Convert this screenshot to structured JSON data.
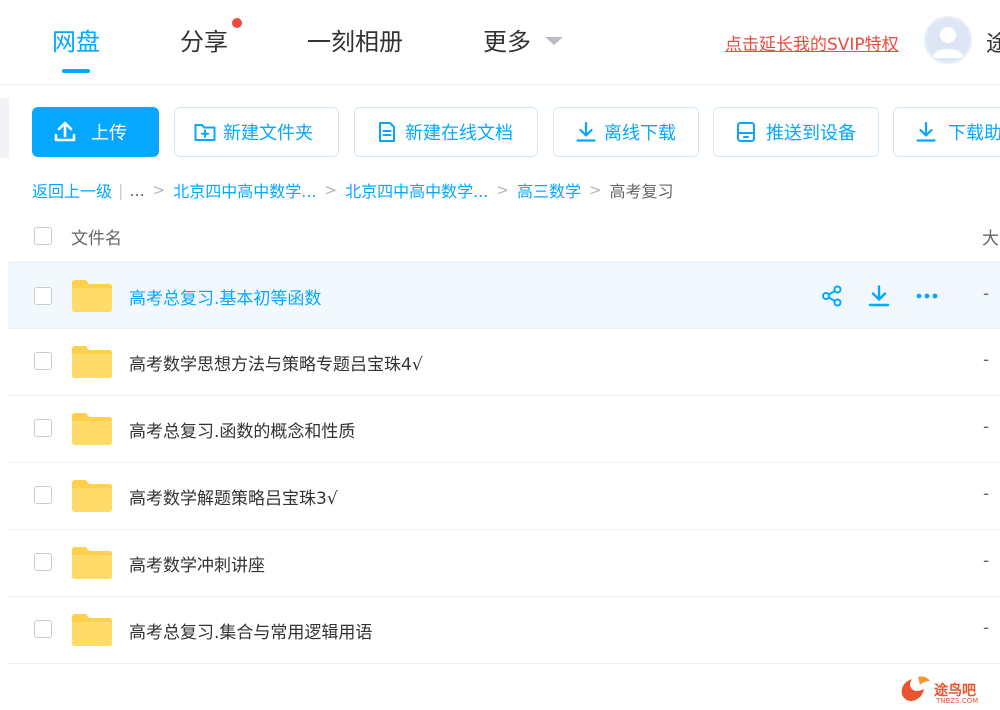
{
  "nav": {
    "tabs": [
      {
        "label": "网盘",
        "active": true
      },
      {
        "label": "分享",
        "badge_dot": true
      },
      {
        "label": "一刻相册"
      },
      {
        "label": "更多"
      }
    ],
    "svip_link": "点击延长我的SVIP特权",
    "user_name_cut": "途"
  },
  "toolbar": {
    "buttons": [
      {
        "label": "上传",
        "icon": "upload-icon",
        "primary": true
      },
      {
        "label": "新建文件夹",
        "icon": "new-folder-icon"
      },
      {
        "label": "新建在线文档",
        "icon": "doc-icon"
      },
      {
        "label": "离线下载",
        "icon": "download-icon"
      },
      {
        "label": "推送到设备",
        "icon": "device-icon"
      },
      {
        "label": "下载助",
        "icon": "download-icon"
      }
    ]
  },
  "breadcrumb": {
    "back": "返回上一级",
    "ellipsis": "...",
    "items": [
      "北京四中高中数学...",
      "北京四中高中数学...",
      "高三数学"
    ],
    "current": "高考复习"
  },
  "table": {
    "header_name": "文件名",
    "header_size": "大",
    "rows": [
      {
        "name": "高考总复习.基本初等函数",
        "size": "-",
        "hover": true
      },
      {
        "name": "高考数学思想方法与策略专题吕宝珠4√",
        "size": "-"
      },
      {
        "name": "高考总复习.函数的概念和性质",
        "size": "-"
      },
      {
        "name": "高考数学解题策略吕宝珠3√",
        "size": "-"
      },
      {
        "name": "高考数学冲刺讲座",
        "size": "-"
      },
      {
        "name": "高考总复习.集合与常用逻辑用语",
        "size": "-"
      }
    ]
  },
  "watermark": {
    "text": "途鸟吧",
    "sub": "TNBZS.COM"
  },
  "colors": {
    "accent": "#06a7ff",
    "red": "#f0483b",
    "folder": "#ffd04b"
  }
}
